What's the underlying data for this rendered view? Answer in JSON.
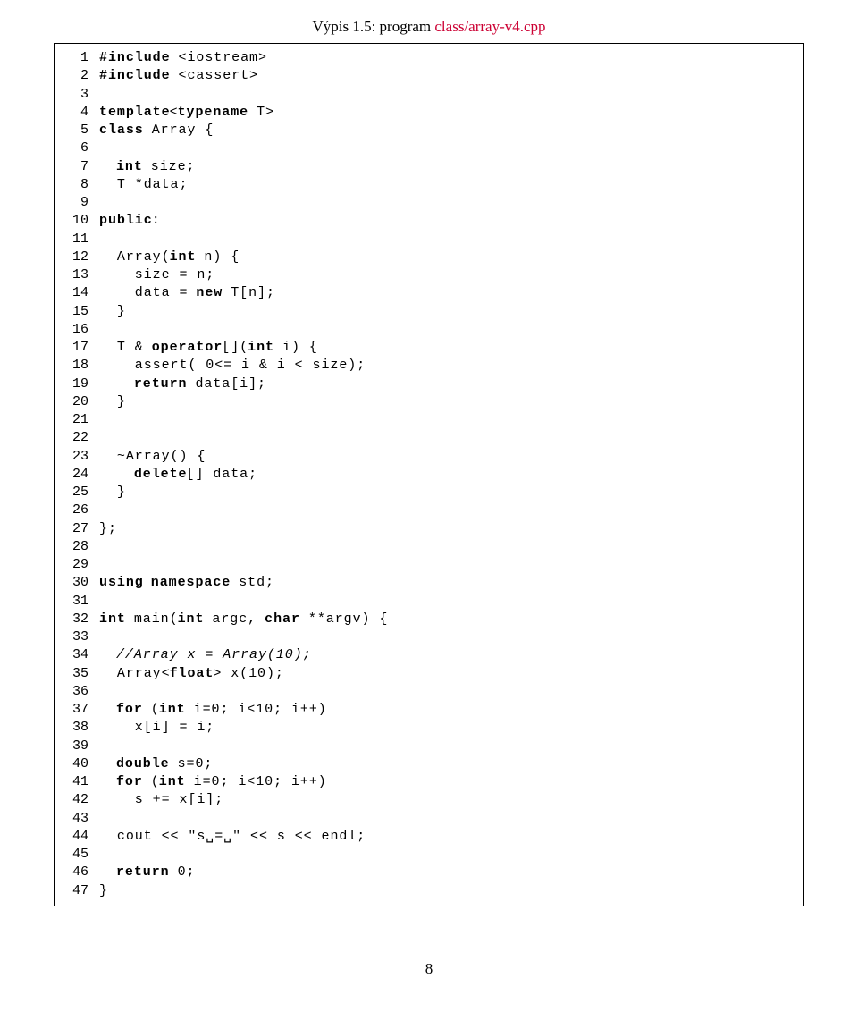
{
  "caption_prefix": "Výpis 1.5: program ",
  "caption_link": "class/array-v4.cpp",
  "page_number": "8",
  "code": [
    {
      "n": "1",
      "tokens": [
        {
          "t": "#include",
          "c": "kw"
        },
        {
          "t": " <iostream>"
        }
      ]
    },
    {
      "n": "2",
      "tokens": [
        {
          "t": "#include",
          "c": "kw"
        },
        {
          "t": " <cassert>"
        }
      ]
    },
    {
      "n": "3",
      "tokens": []
    },
    {
      "n": "4",
      "tokens": [
        {
          "t": "template",
          "c": "kw"
        },
        {
          "t": "<"
        },
        {
          "t": "typename",
          "c": "kw"
        },
        {
          "t": " T>"
        }
      ]
    },
    {
      "n": "5",
      "tokens": [
        {
          "t": "class",
          "c": "kw"
        },
        {
          "t": " Array {"
        }
      ]
    },
    {
      "n": "6",
      "tokens": []
    },
    {
      "n": "7",
      "tokens": [
        {
          "t": "  "
        },
        {
          "t": "int",
          "c": "kw"
        },
        {
          "t": " size;"
        }
      ]
    },
    {
      "n": "8",
      "tokens": [
        {
          "t": "  T *data;"
        }
      ]
    },
    {
      "n": "9",
      "tokens": []
    },
    {
      "n": "10",
      "tokens": [
        {
          "t": "public",
          "c": "kw"
        },
        {
          "t": ":"
        }
      ]
    },
    {
      "n": "11",
      "tokens": []
    },
    {
      "n": "12",
      "tokens": [
        {
          "t": "  Array("
        },
        {
          "t": "int",
          "c": "kw"
        },
        {
          "t": " n) {"
        }
      ]
    },
    {
      "n": "13",
      "tokens": [
        {
          "t": "    size = n;"
        }
      ]
    },
    {
      "n": "14",
      "tokens": [
        {
          "t": "    data = "
        },
        {
          "t": "new",
          "c": "kw"
        },
        {
          "t": " T[n];"
        }
      ]
    },
    {
      "n": "15",
      "tokens": [
        {
          "t": "  }"
        }
      ]
    },
    {
      "n": "16",
      "tokens": []
    },
    {
      "n": "17",
      "tokens": [
        {
          "t": "  T & "
        },
        {
          "t": "operator",
          "c": "kw"
        },
        {
          "t": "[]("
        },
        {
          "t": "int",
          "c": "kw"
        },
        {
          "t": " i) {"
        }
      ]
    },
    {
      "n": "18",
      "tokens": [
        {
          "t": "    assert( 0<= i & i < size);"
        }
      ]
    },
    {
      "n": "19",
      "tokens": [
        {
          "t": "    "
        },
        {
          "t": "return",
          "c": "kw"
        },
        {
          "t": " data[i];"
        }
      ]
    },
    {
      "n": "20",
      "tokens": [
        {
          "t": "  }"
        }
      ]
    },
    {
      "n": "21",
      "tokens": []
    },
    {
      "n": "22",
      "tokens": []
    },
    {
      "n": "23",
      "tokens": [
        {
          "t": "  ~Array() {"
        }
      ]
    },
    {
      "n": "24",
      "tokens": [
        {
          "t": "    "
        },
        {
          "t": "delete",
          "c": "kw"
        },
        {
          "t": "[] data;"
        }
      ]
    },
    {
      "n": "25",
      "tokens": [
        {
          "t": "  }"
        }
      ]
    },
    {
      "n": "26",
      "tokens": []
    },
    {
      "n": "27",
      "tokens": [
        {
          "t": "};"
        }
      ]
    },
    {
      "n": "28",
      "tokens": []
    },
    {
      "n": "29",
      "tokens": []
    },
    {
      "n": "30",
      "tokens": [
        {
          "t": "using",
          "c": "kw"
        },
        {
          "t": " "
        },
        {
          "t": "namespace",
          "c": "kw"
        },
        {
          "t": " std;"
        }
      ]
    },
    {
      "n": "31",
      "tokens": []
    },
    {
      "n": "32",
      "tokens": [
        {
          "t": "int",
          "c": "kw"
        },
        {
          "t": " main("
        },
        {
          "t": "int",
          "c": "kw"
        },
        {
          "t": " argc, "
        },
        {
          "t": "char",
          "c": "kw"
        },
        {
          "t": " **argv) {"
        }
      ]
    },
    {
      "n": "33",
      "tokens": []
    },
    {
      "n": "34",
      "tokens": [
        {
          "t": "  "
        },
        {
          "t": "//Array x = Array(10);",
          "c": "cm"
        }
      ]
    },
    {
      "n": "35",
      "tokens": [
        {
          "t": "  Array<"
        },
        {
          "t": "float",
          "c": "kw"
        },
        {
          "t": "> x(10);"
        }
      ]
    },
    {
      "n": "36",
      "tokens": []
    },
    {
      "n": "37",
      "tokens": [
        {
          "t": "  "
        },
        {
          "t": "for",
          "c": "kw"
        },
        {
          "t": " ("
        },
        {
          "t": "int",
          "c": "kw"
        },
        {
          "t": " i=0; i<10; i++)"
        }
      ]
    },
    {
      "n": "38",
      "tokens": [
        {
          "t": "    x[i] = i;"
        }
      ]
    },
    {
      "n": "39",
      "tokens": []
    },
    {
      "n": "40",
      "tokens": [
        {
          "t": "  "
        },
        {
          "t": "double",
          "c": "kw"
        },
        {
          "t": " s=0;"
        }
      ]
    },
    {
      "n": "41",
      "tokens": [
        {
          "t": "  "
        },
        {
          "t": "for",
          "c": "kw"
        },
        {
          "t": " ("
        },
        {
          "t": "int",
          "c": "kw"
        },
        {
          "t": " i=0; i<10; i++)"
        }
      ]
    },
    {
      "n": "42",
      "tokens": [
        {
          "t": "    s += x[i];"
        }
      ]
    },
    {
      "n": "43",
      "tokens": []
    },
    {
      "n": "44",
      "tokens": [
        {
          "t": "  cout << \"s␣=␣\" << s << endl;"
        }
      ]
    },
    {
      "n": "45",
      "tokens": []
    },
    {
      "n": "46",
      "tokens": [
        {
          "t": "  "
        },
        {
          "t": "return",
          "c": "kw"
        },
        {
          "t": " 0;"
        }
      ]
    },
    {
      "n": "47",
      "tokens": [
        {
          "t": "}"
        }
      ]
    }
  ]
}
